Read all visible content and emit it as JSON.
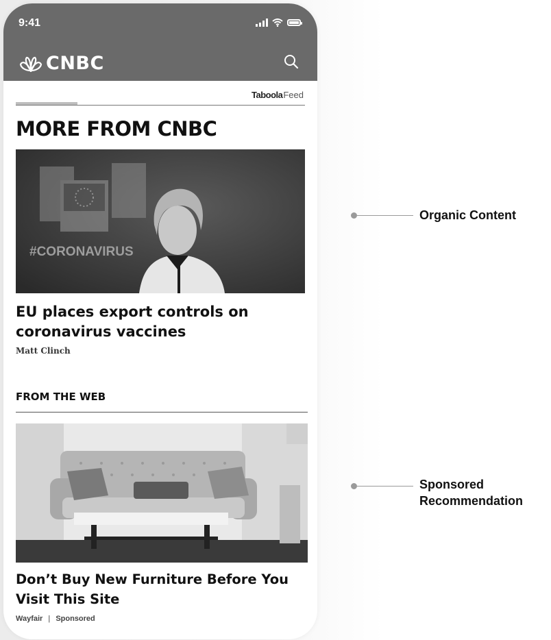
{
  "status_bar": {
    "time": "9:41"
  },
  "header": {
    "brand": "CNBC"
  },
  "feed": {
    "provider_brand": "Taboola",
    "provider_suffix": "Feed",
    "section_title": "MORE FROM CNBC",
    "organic": {
      "image_overlay_text": "#CORONAVIRUS",
      "title": "EU places export controls on coronavirus vaccines",
      "author": "Matt Clinch"
    },
    "web_section_title": "FROM THE WEB",
    "sponsored": {
      "title": "Don’t Buy New Furniture Before You Visit This Site",
      "source": "Wayfair",
      "separator": "|",
      "label": "Sponsored"
    }
  },
  "callouts": {
    "organic": "Organic Content",
    "sponsored": "Sponsored Recommendation"
  },
  "colors": {
    "header_bg": "#6a6a6a",
    "callout_gray": "#9a9a9a"
  },
  "icons": [
    "cnbc-peacock-icon",
    "search-icon",
    "signal-icon",
    "wifi-icon",
    "battery-icon"
  ]
}
